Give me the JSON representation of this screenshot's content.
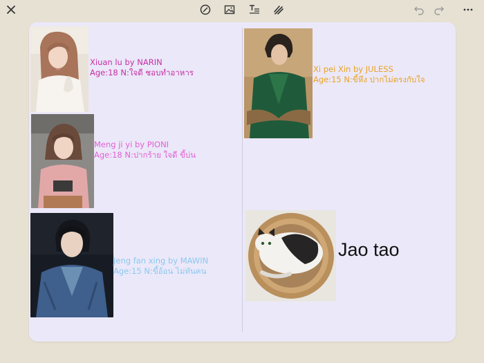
{
  "toolbar": {
    "close_icon": "close-icon",
    "tools": [
      "lasso-icon",
      "image-icon",
      "text-format-icon",
      "pen-scribble-icon"
    ],
    "history": [
      "undo-icon",
      "redo-icon"
    ],
    "more_icon": "more-icon"
  },
  "cards": [
    {
      "line1": "Xiuan lu by NARIN",
      "line2": "Age:18 N:ใจดี ชอบทำอาหาร",
      "color": "#c62ea3"
    },
    {
      "line1": "Meng ji yi by PIONI",
      "line2": "Age:18 N:ปากร้าย ใจดี ขี้บ่น",
      "color": "#e35fd2"
    },
    {
      "line1": "Jeng fan xing by MAWIN",
      "line2": "Age:15 N:ขี้อ้อน ไม่ทันคน",
      "color": "#8ac9ee"
    },
    {
      "line1": "Xi pei Xin by JULESS",
      "line2": "Age:15 N:ขี้หึง ปากไม่ตรงกับใจ",
      "color": "#eba322"
    }
  ],
  "cat_label": "Jao tao",
  "colors": {
    "background": "#e6e1d3",
    "canvas": "#ebe8f9",
    "divider": "#cfcbe0"
  }
}
